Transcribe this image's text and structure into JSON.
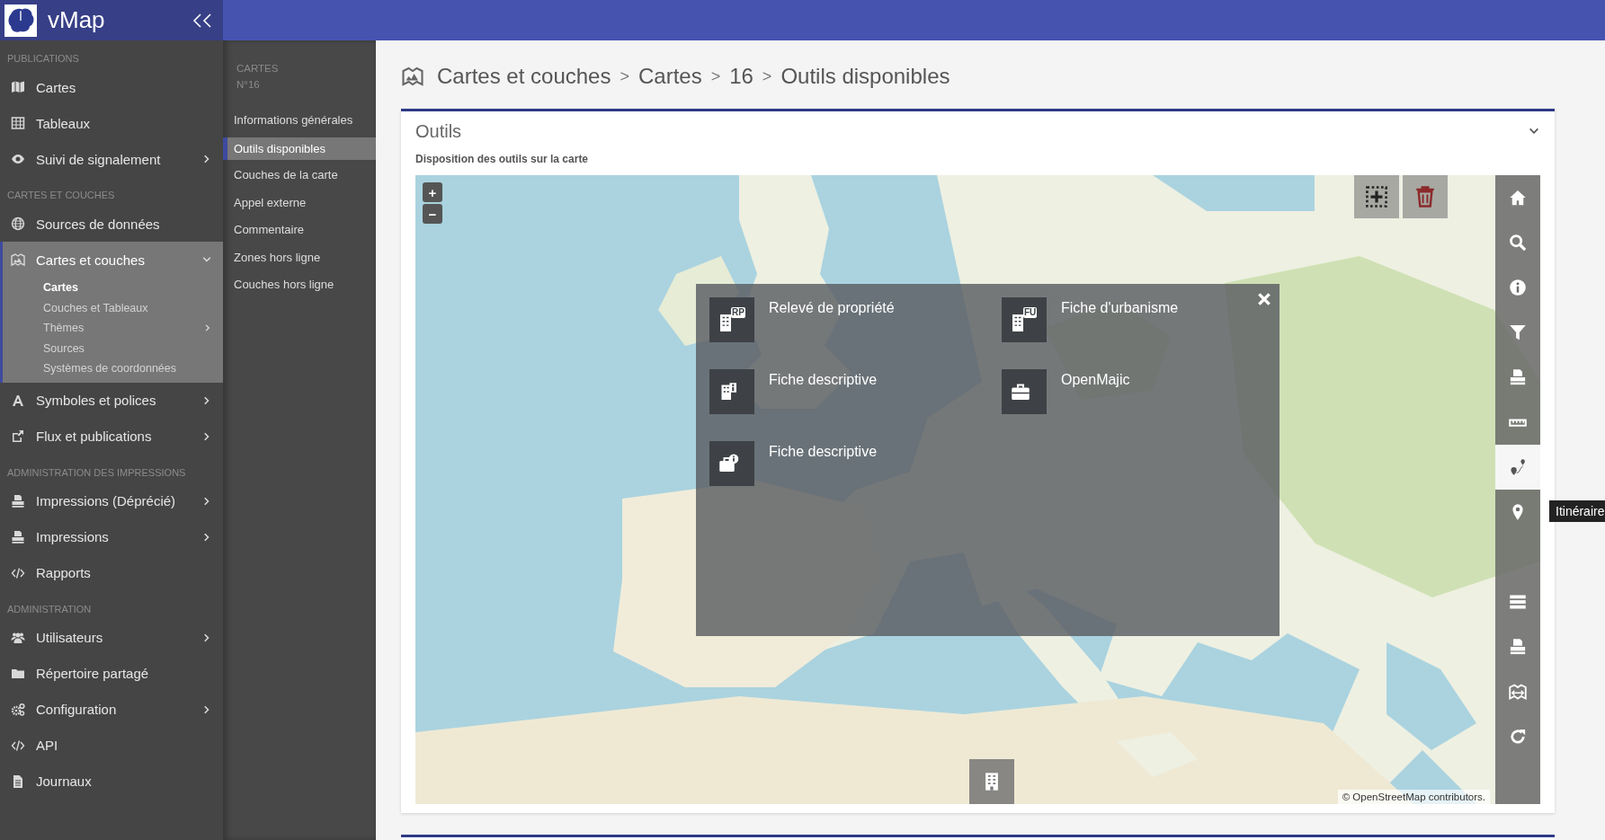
{
  "header": {
    "app_name": "vMap"
  },
  "sidebar": {
    "sections": [
      {
        "title": "PUBLICATIONS",
        "items": [
          {
            "label": "Cartes",
            "selected": false,
            "expandable": false
          },
          {
            "label": "Tableaux",
            "selected": false,
            "expandable": false
          },
          {
            "label": "Suivi de signalement",
            "selected": false,
            "expandable": true,
            "expanded": false
          }
        ]
      },
      {
        "title": "CARTES ET COUCHES",
        "items": [
          {
            "label": "Sources de données",
            "selected": false,
            "expandable": false
          },
          {
            "label": "Cartes et couches",
            "selected": true,
            "expandable": true,
            "expanded": true,
            "children": [
              {
                "label": "Cartes",
                "selected": true,
                "expandable": false
              },
              {
                "label": "Couches et Tableaux",
                "selected": false,
                "expandable": false
              },
              {
                "label": "Thèmes",
                "selected": false,
                "expandable": true
              },
              {
                "label": "Sources",
                "selected": false,
                "expandable": false
              },
              {
                "label": "Systèmes de coordonnées",
                "selected": false,
                "expandable": false
              }
            ]
          },
          {
            "label": "Symboles et polices",
            "selected": false,
            "expandable": true,
            "expanded": false
          },
          {
            "label": "Flux et publications",
            "selected": false,
            "expandable": true,
            "expanded": false
          }
        ]
      },
      {
        "title": "ADMINISTRATION DES IMPRESSIONS",
        "items": [
          {
            "label": "Impressions (Déprécié)",
            "selected": false,
            "expandable": true,
            "expanded": false
          },
          {
            "label": "Impressions",
            "selected": false,
            "expandable": true,
            "expanded": false
          },
          {
            "label": "Rapports",
            "selected": false,
            "expandable": false
          }
        ]
      },
      {
        "title": "ADMINISTRATION",
        "items": [
          {
            "label": "Utilisateurs",
            "selected": false,
            "expandable": true,
            "expanded": false
          },
          {
            "label": "Répertoire partagé",
            "selected": false,
            "expandable": false
          },
          {
            "label": "Configuration",
            "selected": false,
            "expandable": true,
            "expanded": false
          },
          {
            "label": "API",
            "selected": false,
            "expandable": false
          },
          {
            "label": "Journaux",
            "selected": false,
            "expandable": false
          }
        ]
      }
    ]
  },
  "subnav": {
    "title": "CARTES",
    "subtitle": "N°16",
    "items": [
      {
        "label": "Informations générales",
        "selected": false
      },
      {
        "label": "Outils disponibles",
        "selected": true
      },
      {
        "label": "Couches de la carte",
        "selected": false
      },
      {
        "label": "Appel externe",
        "selected": false
      },
      {
        "label": "Commentaire",
        "selected": false
      },
      {
        "label": "Zones hors ligne",
        "selected": false
      },
      {
        "label": "Couches hors ligne",
        "selected": false
      }
    ]
  },
  "breadcrumb": [
    {
      "label": "Cartes et couches"
    },
    {
      "separator": ">",
      "label": "Cartes"
    },
    {
      "separator": ">",
      "label": "16"
    },
    {
      "separator": ">",
      "label": "Outils disponibles"
    }
  ],
  "card": {
    "title": "Outils",
    "subtitle": "Disposition des outils sur la carte"
  },
  "map": {
    "zoom_in": "+",
    "zoom_out": "−",
    "toolbar": [
      {
        "kind": "button",
        "selected": false
      },
      {
        "kind": "button",
        "selected": false
      },
      {
        "kind": "button",
        "selected": false
      },
      {
        "kind": "button",
        "selected": false
      },
      {
        "kind": "button",
        "selected": false
      },
      {
        "kind": "button",
        "selected": false
      },
      {
        "kind": "button",
        "selected": true
      },
      {
        "kind": "button",
        "selected": false,
        "tooltip": "Itinéraire"
      },
      {
        "kind": "empty"
      },
      {
        "kind": "button",
        "selected": false
      },
      {
        "kind": "button",
        "selected": false
      },
      {
        "kind": "button",
        "selected": false
      },
      {
        "kind": "button",
        "selected": false
      },
      {
        "kind": "empty"
      }
    ],
    "tools_panel": {
      "items": [
        {
          "label": "Relevé de propriété",
          "badge": "RP"
        },
        {
          "label": "Fiche d'urbanisme",
          "badge": "FU"
        },
        {
          "label": "Fiche descriptive"
        },
        {
          "label": "OpenMajic"
        },
        {
          "label": "Fiche descriptive"
        }
      ]
    },
    "attribution": "© OpenStreetMap contributors."
  }
}
